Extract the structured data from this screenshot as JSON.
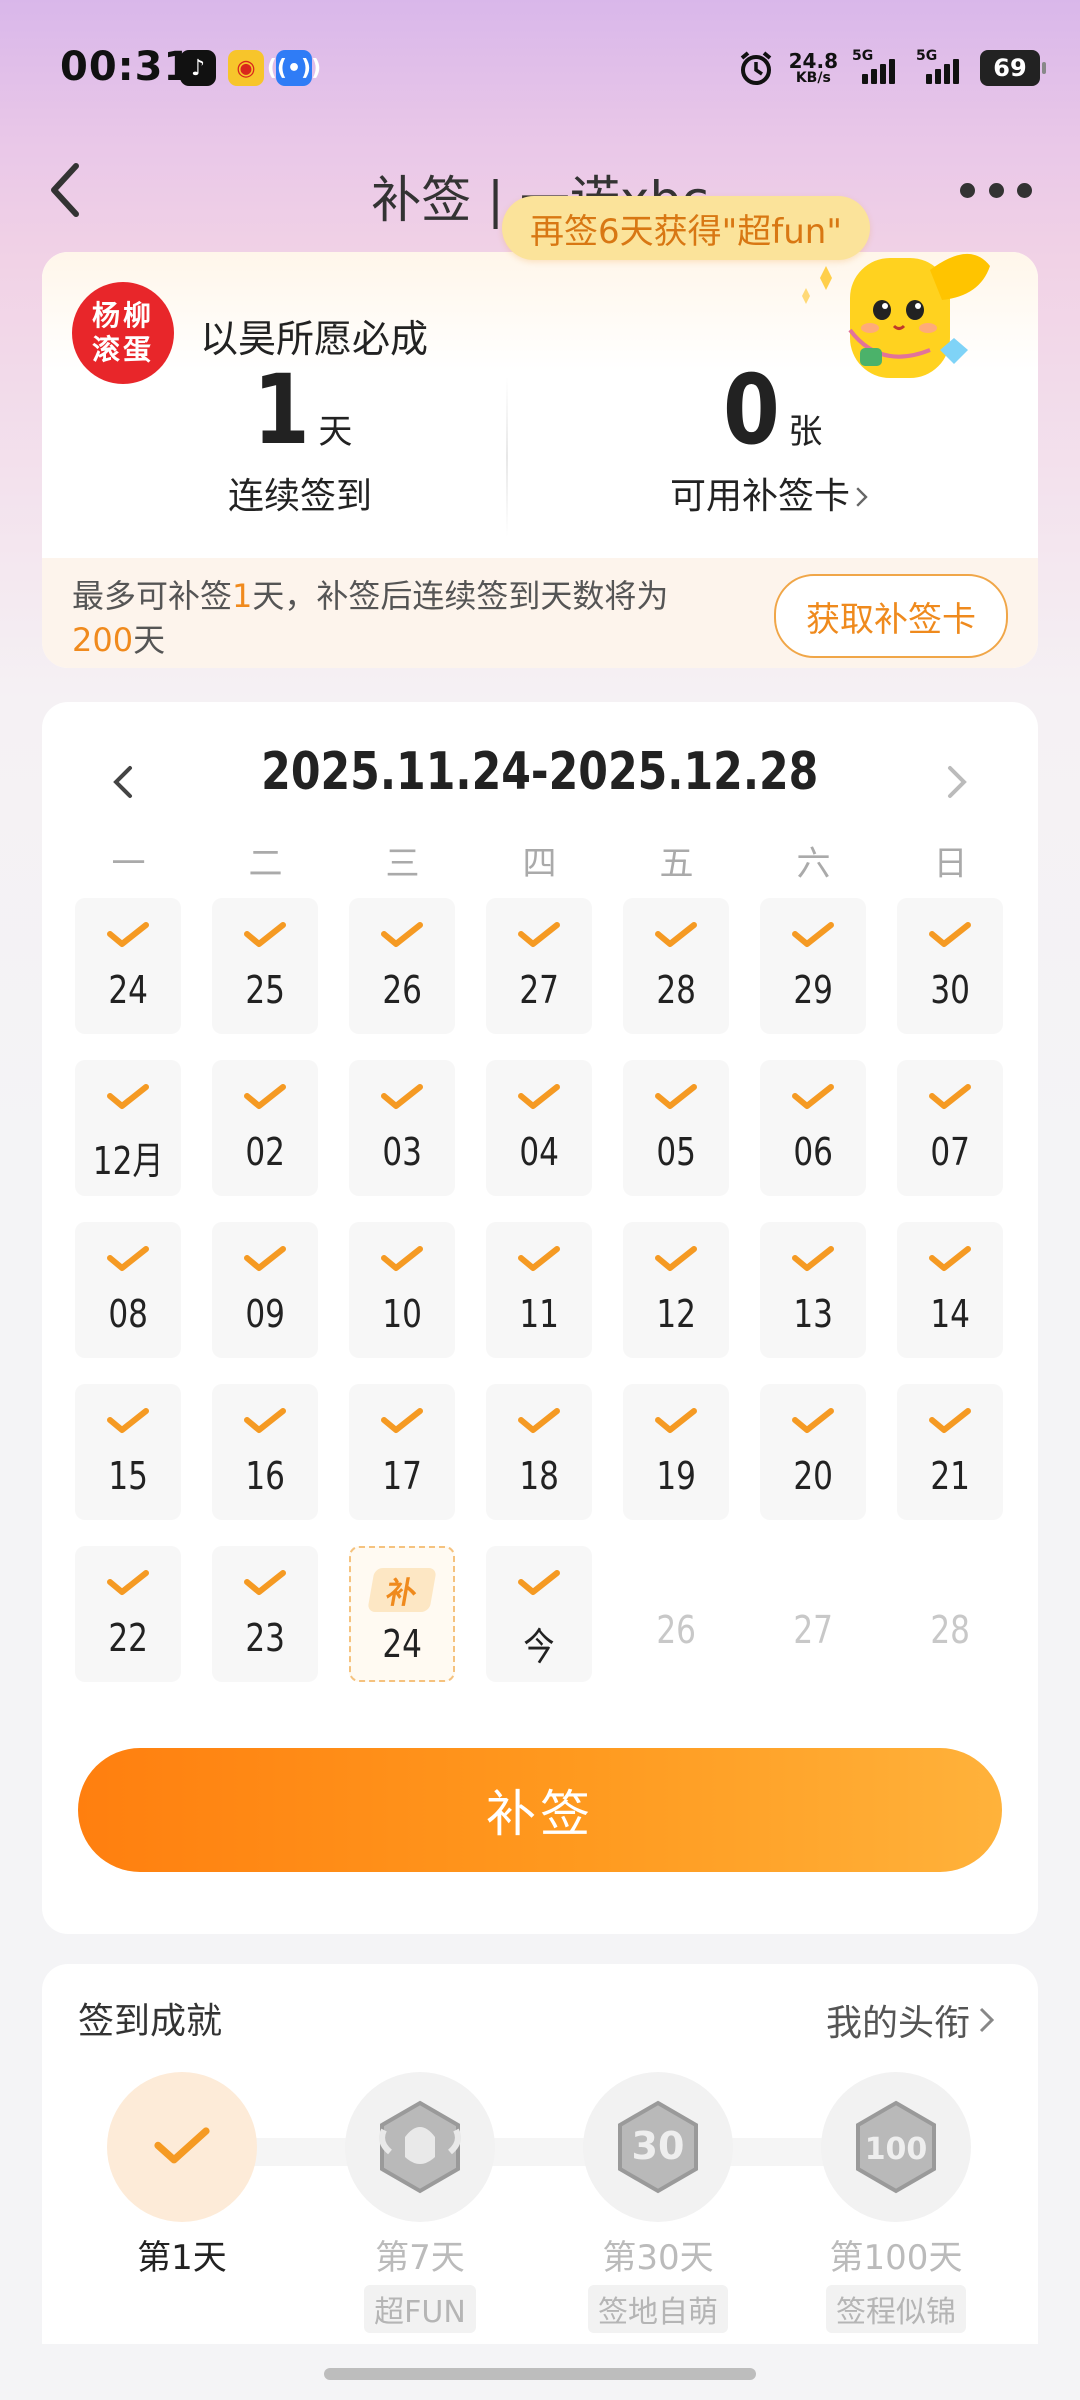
{
  "status_bar": {
    "time": "00:31",
    "net_speed_value": "24.8",
    "net_speed_unit": "KB/s",
    "signal1_label": "5G",
    "signal2_label": "5G",
    "battery": "69",
    "apps": [
      "tiktok-icon",
      "weibo-icon",
      "radar-icon"
    ]
  },
  "header": {
    "title": "补签 | 一诺xbc",
    "reward_bubble": "再签6天获得\"超fun\""
  },
  "summary": {
    "avatar_text_top": "杨柳",
    "avatar_text_bottom": "滚蛋",
    "username": "以昊所愿必成",
    "streak_value": "1",
    "streak_unit": "天",
    "streak_label": "连续签到",
    "cards_value": "0",
    "cards_unit": "张",
    "cards_label": "可用补签卡",
    "note_part1": "最多可补签",
    "note_hl1": "1",
    "note_part2": "天，补签后连续签到天数将为",
    "note_hl2": "200",
    "note_part3": "天",
    "get_card_button": "获取补签卡"
  },
  "calendar": {
    "range": "2025.11.24-2025.12.28",
    "weekdays": [
      "一",
      "二",
      "三",
      "四",
      "五",
      "六",
      "日"
    ],
    "days": [
      {
        "label": "24",
        "state": "checked"
      },
      {
        "label": "25",
        "state": "checked"
      },
      {
        "label": "26",
        "state": "checked"
      },
      {
        "label": "27",
        "state": "checked"
      },
      {
        "label": "28",
        "state": "checked"
      },
      {
        "label": "29",
        "state": "checked"
      },
      {
        "label": "30",
        "state": "checked"
      },
      {
        "label": "12月",
        "state": "checked"
      },
      {
        "label": "02",
        "state": "checked"
      },
      {
        "label": "03",
        "state": "checked"
      },
      {
        "label": "04",
        "state": "checked"
      },
      {
        "label": "05",
        "state": "checked"
      },
      {
        "label": "06",
        "state": "checked"
      },
      {
        "label": "07",
        "state": "checked"
      },
      {
        "label": "08",
        "state": "checked"
      },
      {
        "label": "09",
        "state": "checked"
      },
      {
        "label": "10",
        "state": "checked"
      },
      {
        "label": "11",
        "state": "checked"
      },
      {
        "label": "12",
        "state": "checked"
      },
      {
        "label": "13",
        "state": "checked"
      },
      {
        "label": "14",
        "state": "checked"
      },
      {
        "label": "15",
        "state": "checked"
      },
      {
        "label": "16",
        "state": "checked"
      },
      {
        "label": "17",
        "state": "checked"
      },
      {
        "label": "18",
        "state": "checked"
      },
      {
        "label": "19",
        "state": "checked"
      },
      {
        "label": "20",
        "state": "checked"
      },
      {
        "label": "21",
        "state": "checked"
      },
      {
        "label": "22",
        "state": "checked"
      },
      {
        "label": "23",
        "state": "checked"
      },
      {
        "label": "24",
        "state": "makeup",
        "tag": "补"
      },
      {
        "label": "今",
        "state": "checked"
      },
      {
        "label": "26",
        "state": "future"
      },
      {
        "label": "27",
        "state": "future"
      },
      {
        "label": "28",
        "state": "future"
      }
    ],
    "makeup_button": "补签"
  },
  "achievements": {
    "title": "签到成就",
    "link": "我的头衔",
    "items": [
      {
        "name": "第1天",
        "tag": "",
        "done": true
      },
      {
        "name": "第7天",
        "tag": "超FUN",
        "done": false
      },
      {
        "name": "第30天",
        "tag": "签地自萌",
        "done": false
      },
      {
        "name": "第100天",
        "tag": "签程似锦",
        "done": false
      }
    ]
  },
  "colors": {
    "accent": "#ff8a1a",
    "check": "#f59a23",
    "highlight_text": "#f08a1d"
  }
}
